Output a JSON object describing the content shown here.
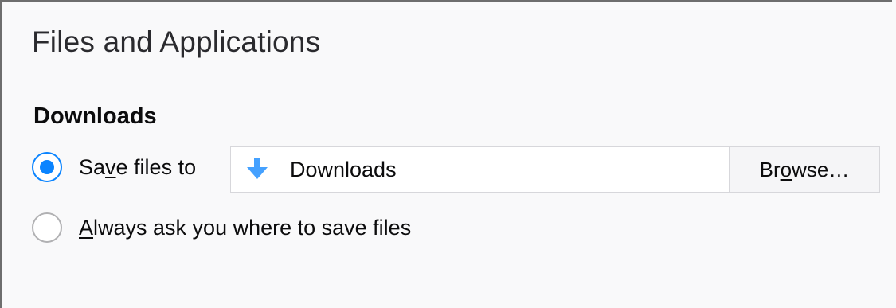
{
  "page": {
    "title": "Files and Applications"
  },
  "downloads": {
    "heading": "Downloads",
    "save_option": {
      "label_pre": "Sa",
      "label_access_key": "v",
      "label_post": "e files to",
      "checked": true
    },
    "folder": {
      "icon": "download-arrow-icon",
      "value": "Downloads"
    },
    "browse_button": {
      "label_pre": "Br",
      "label_access_key": "o",
      "label_post": "wse…"
    },
    "ask_option": {
      "label_access_key": "A",
      "label_post": "lways ask you where to save files",
      "checked": false
    }
  },
  "colors": {
    "accent": "#0a84ff",
    "icon_blue": "#45a1ff",
    "background": "#f9f9fa"
  }
}
